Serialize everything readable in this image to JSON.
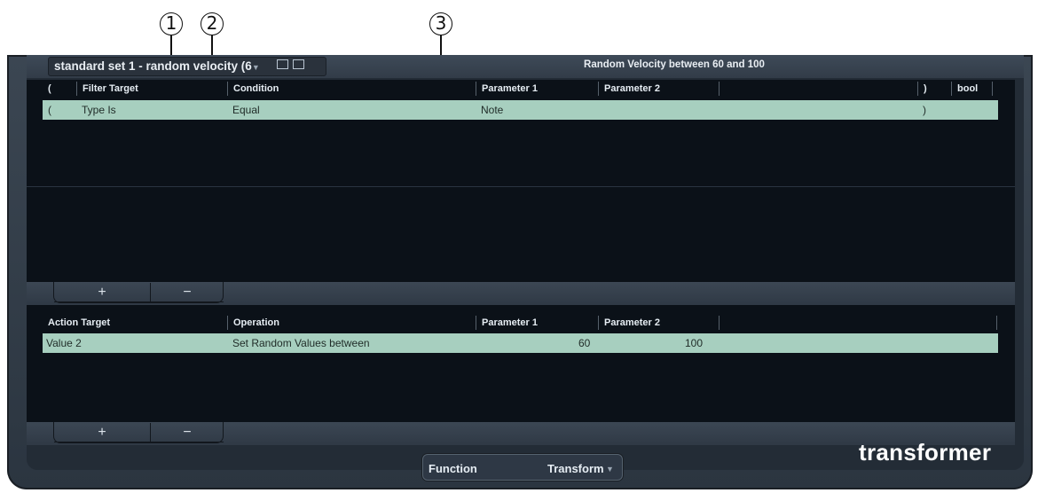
{
  "callouts": [
    "1",
    "2",
    "3"
  ],
  "preset": {
    "name": "standard set 1 - random velocity (6",
    "title": "Random Velocity between 60 and 100"
  },
  "filter": {
    "headers": [
      "(",
      "Filter Target",
      "Condition",
      "Parameter 1",
      "Parameter 2",
      ")",
      "bool"
    ],
    "rows": [
      {
        "open_paren": "(",
        "target": "Type Is",
        "condition": "Equal",
        "param1": "Note",
        "param2": "",
        "close_paren": ")",
        "bool": ""
      }
    ]
  },
  "action": {
    "headers": [
      "Action Target",
      "Operation",
      "Parameter 1",
      "Parameter 2"
    ],
    "rows": [
      {
        "target": "Value 2",
        "operation": "Set Random Values between",
        "param1": "60",
        "param2": "100"
      }
    ]
  },
  "buttons": {
    "add": "+",
    "remove": "−"
  },
  "function": {
    "label": "Function",
    "value": "Transform"
  },
  "brand": "transformer",
  "colors": {
    "selected_row": "#a7cfbf",
    "panel_bg": "#0b1118",
    "frame": "#2f3945"
  }
}
